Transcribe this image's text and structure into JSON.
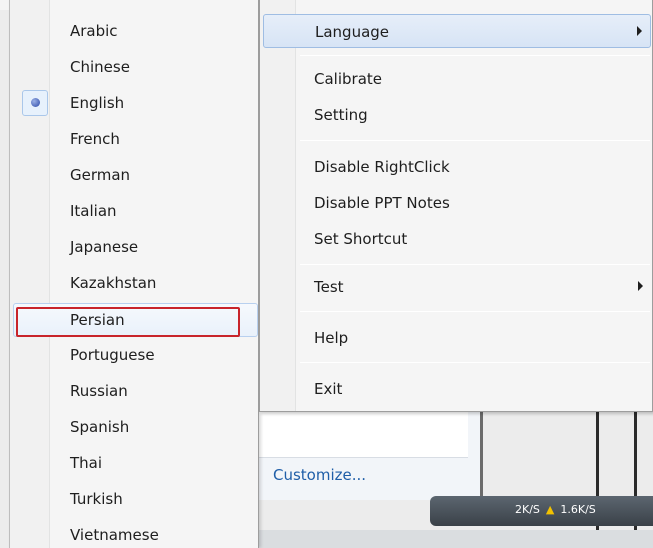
{
  "language_menu": {
    "items": [
      {
        "label": "Arabic"
      },
      {
        "label": "Chinese"
      },
      {
        "label": "English",
        "checked": true
      },
      {
        "label": "French"
      },
      {
        "label": "German"
      },
      {
        "label": "Italian"
      },
      {
        "label": "Japanese"
      },
      {
        "label": "Kazakhstan"
      },
      {
        "label": "Persian",
        "hovered": true,
        "highlighted": true
      },
      {
        "label": "Portuguese"
      },
      {
        "label": "Russian"
      },
      {
        "label": "Spanish"
      },
      {
        "label": "Thai"
      },
      {
        "label": "Turkish"
      },
      {
        "label": "Vietnamese"
      }
    ]
  },
  "context_menu": {
    "language": "Language",
    "calibrate": "Calibrate",
    "setting": "Setting",
    "disable_rightclick": "Disable RightClick",
    "disable_ppt_notes": "Disable PPT Notes",
    "set_shortcut": "Set Shortcut",
    "test": "Test",
    "help": "Help",
    "exit": "Exit"
  },
  "background": {
    "customize_link": "Customize...",
    "upload_speed": "2K/S",
    "download_speed": "1.6K/S",
    "upload-arrow-icon": "up-arrow-icon"
  },
  "colors": {
    "highlight_border": "#c8242b",
    "link": "#1f5ea8",
    "hover_bg": "#e9f1fb"
  }
}
